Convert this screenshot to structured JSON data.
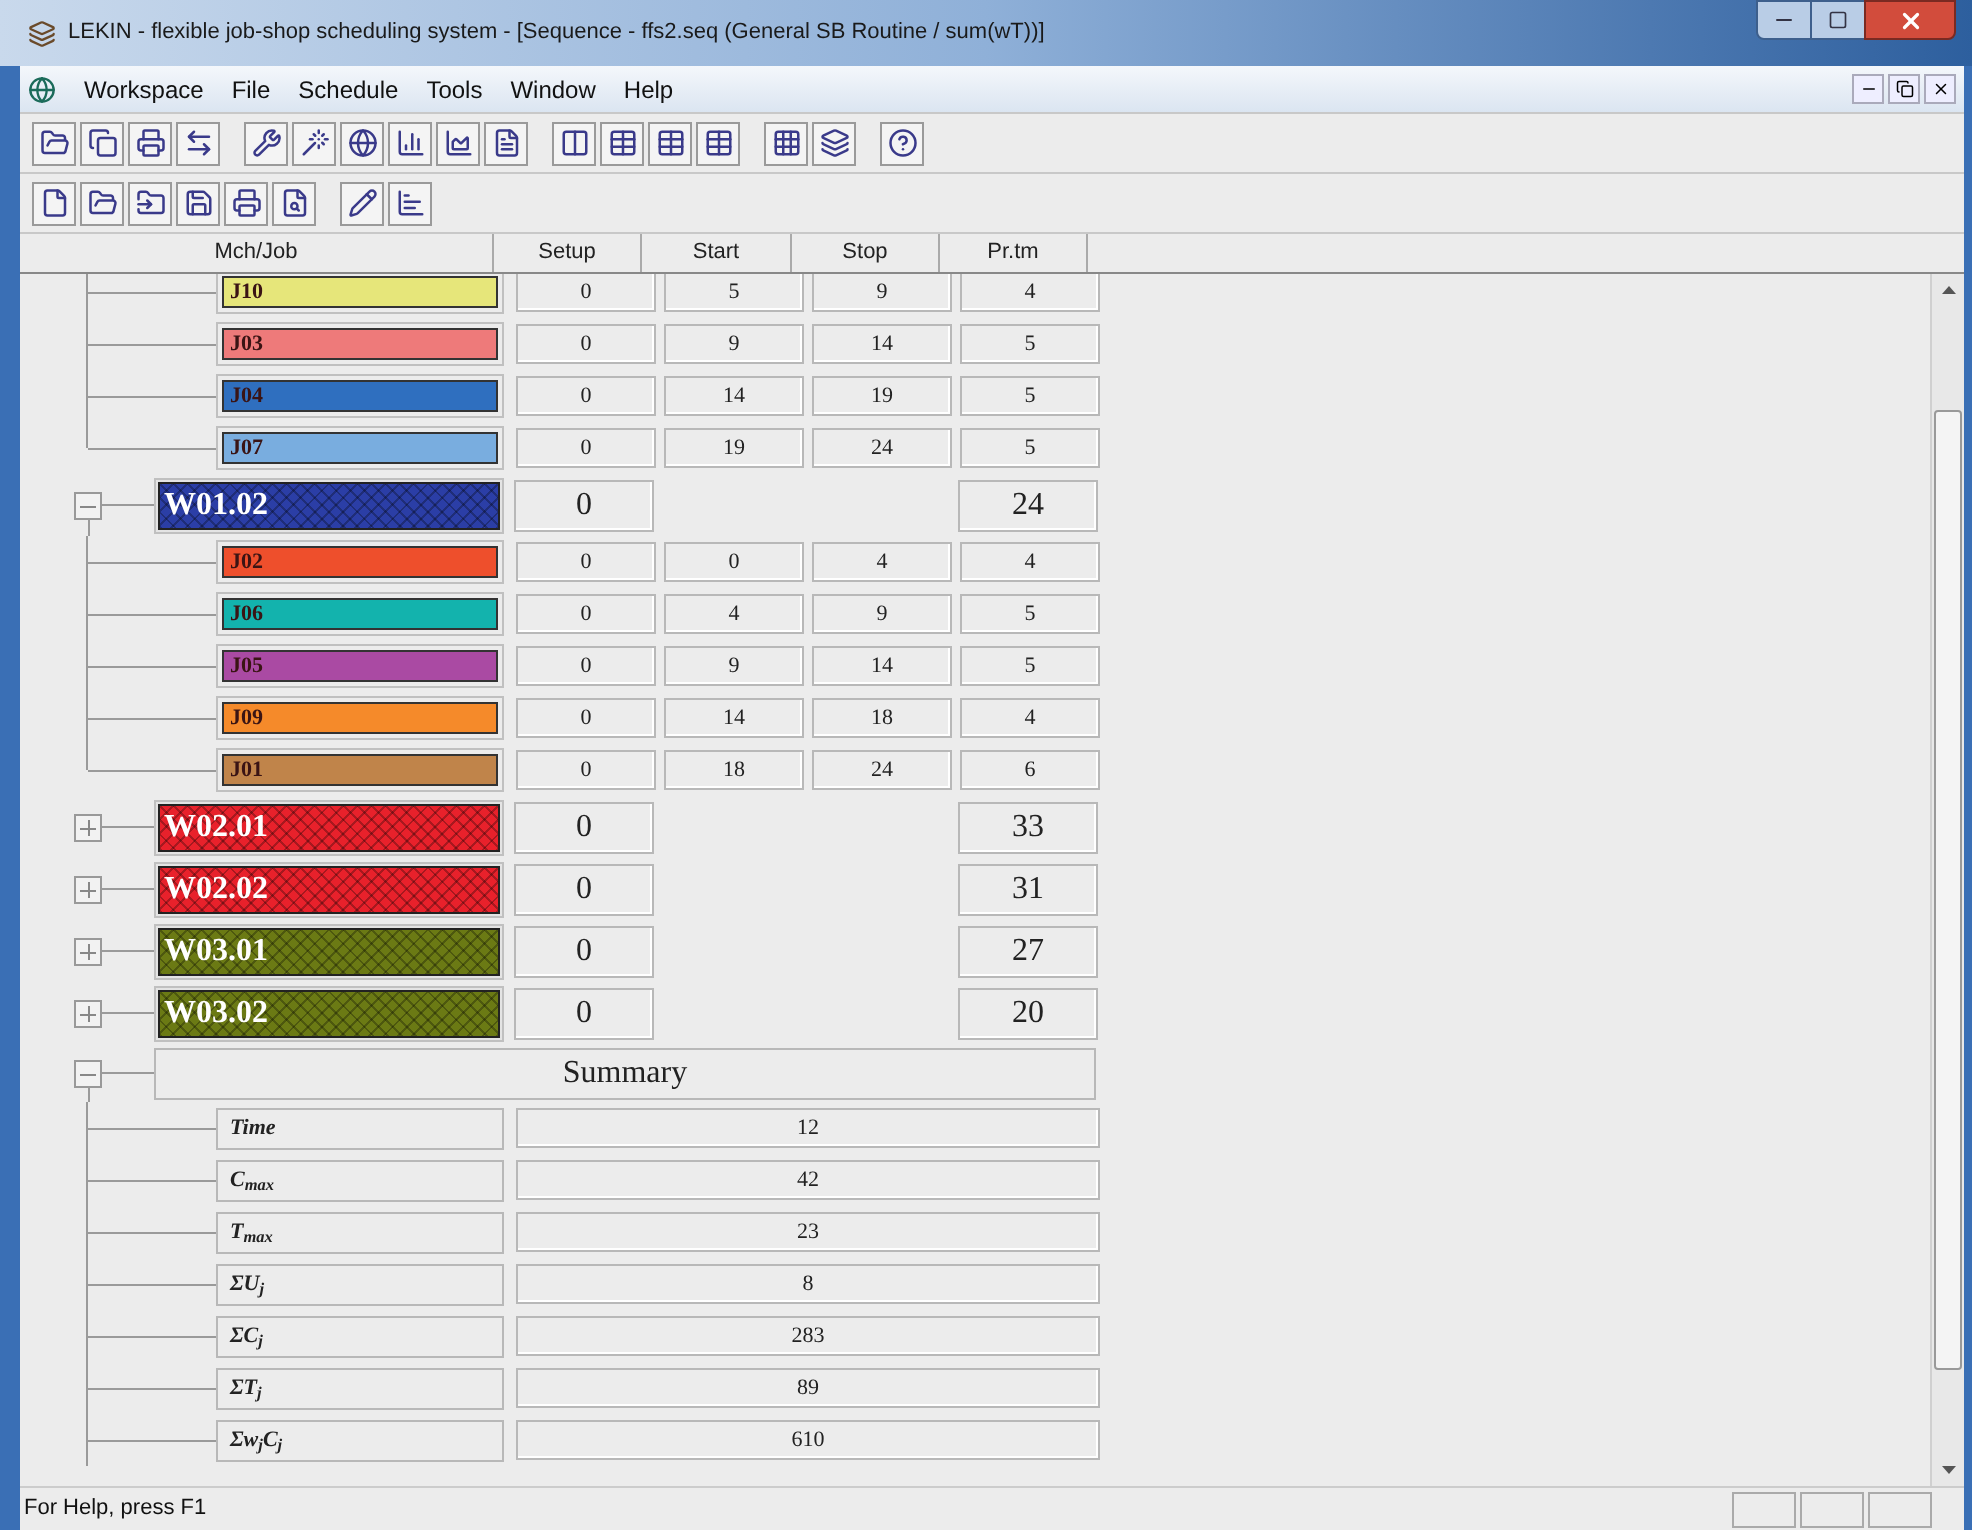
{
  "window": {
    "title": "LEKIN - flexible job-shop scheduling system - [Sequence - ffs2.seq (General SB Routine / sum(wT))]"
  },
  "menu": [
    "Workspace",
    "File",
    "Schedule",
    "Tools",
    "Window",
    "Help"
  ],
  "table": {
    "columns": [
      "Mch/Job",
      "Setup",
      "Start",
      "Stop",
      "Pr.tm"
    ]
  },
  "tree": [
    {
      "kind": "jobs",
      "jobs": [
        {
          "name": "J10",
          "color": "#e6e67a",
          "setup": "0",
          "start": "5",
          "stop": "9",
          "prtm": "4"
        },
        {
          "name": "J03",
          "color": "#ee7a7a",
          "setup": "0",
          "start": "9",
          "stop": "14",
          "prtm": "5"
        },
        {
          "name": "J04",
          "color": "#2f6fbf",
          "setup": "0",
          "start": "14",
          "stop": "19",
          "prtm": "5"
        },
        {
          "name": "J07",
          "color": "#79addf",
          "setup": "0",
          "start": "19",
          "stop": "24",
          "prtm": "5"
        }
      ]
    },
    {
      "kind": "machine",
      "name": "W01.02",
      "color": "#2b3ea6",
      "expanded": true,
      "setup": "0",
      "prtm": "24",
      "jobs": [
        {
          "name": "J02",
          "color": "#ee4f2c",
          "setup": "0",
          "start": "0",
          "stop": "4",
          "prtm": "4"
        },
        {
          "name": "J06",
          "color": "#13b3ad",
          "setup": "0",
          "start": "4",
          "stop": "9",
          "prtm": "5"
        },
        {
          "name": "J05",
          "color": "#aa4aa3",
          "setup": "0",
          "start": "9",
          "stop": "14",
          "prtm": "5"
        },
        {
          "name": "J09",
          "color": "#f58a2a",
          "setup": "0",
          "start": "14",
          "stop": "18",
          "prtm": "4"
        },
        {
          "name": "J01",
          "color": "#c0844a",
          "setup": "0",
          "start": "18",
          "stop": "24",
          "prtm": "6"
        }
      ]
    },
    {
      "kind": "machine",
      "name": "W02.01",
      "color": "#e8212b",
      "expanded": false,
      "setup": "0",
      "prtm": "33"
    },
    {
      "kind": "machine",
      "name": "W02.02",
      "color": "#e8212b",
      "expanded": false,
      "setup": "0",
      "prtm": "31"
    },
    {
      "kind": "machine",
      "name": "W03.01",
      "color": "#6b7a14",
      "expanded": false,
      "setup": "0",
      "prtm": "27"
    },
    {
      "kind": "machine",
      "name": "W03.02",
      "color": "#6b7a14",
      "expanded": false,
      "setup": "0",
      "prtm": "20"
    },
    {
      "kind": "summary",
      "name": "Summary",
      "expanded": true,
      "rows": [
        {
          "label": "Time",
          "value": "12"
        },
        {
          "label": "C$_{max}$",
          "value": "42"
        },
        {
          "label": "T$_{max}$",
          "value": "23"
        },
        {
          "label": "ΣU$_{j}$",
          "value": "8"
        },
        {
          "label": "ΣC$_{j}$",
          "value": "283"
        },
        {
          "label": "ΣT$_{j}$",
          "value": "89"
        },
        {
          "label": "Σw$_{j}$C$_{j}$",
          "value": "610"
        }
      ]
    }
  ],
  "status_bar": {
    "text": "For Help, press F1"
  }
}
